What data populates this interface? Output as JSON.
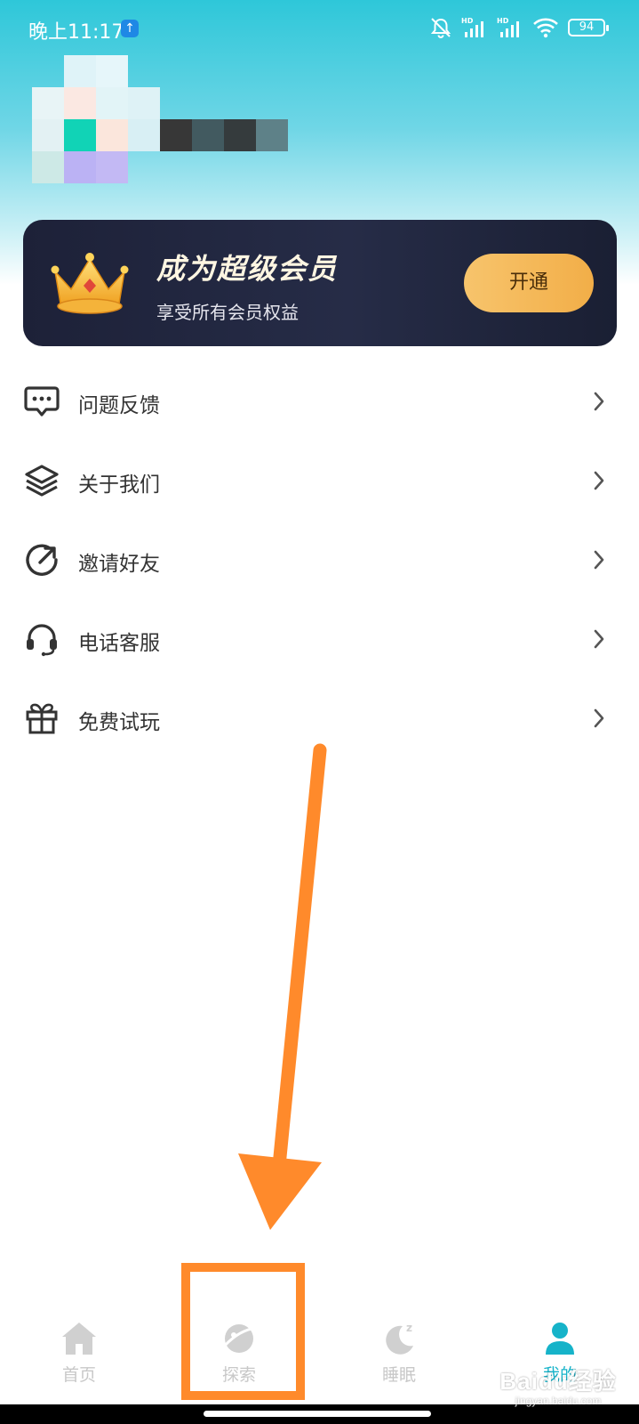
{
  "status_bar": {
    "time": "晚上11:17",
    "upload_indicator": "↑",
    "battery": "94",
    "icons": [
      "bell-off-icon",
      "hd-signal-icon",
      "hd-signal-icon",
      "wifi-icon",
      "battery-icon"
    ]
  },
  "profile": {
    "avatar": "pixelated-avatar",
    "name": "pixelated-username"
  },
  "vip_banner": {
    "title": "成为超级会员",
    "subtitle": "享受所有会员权益",
    "button_label": "开通",
    "icon": "crown-icon"
  },
  "menu": {
    "items": [
      {
        "label": "问题反馈",
        "icon": "feedback-chat-icon"
      },
      {
        "label": "关于我们",
        "icon": "layers-icon"
      },
      {
        "label": "邀请好友",
        "icon": "share-circle-arrow-icon"
      },
      {
        "label": "电话客服",
        "icon": "headset-icon"
      },
      {
        "label": "免费试玩",
        "icon": "gift-icon"
      }
    ]
  },
  "bottom_nav": {
    "items": [
      {
        "label": "首页",
        "icon": "home-icon",
        "active": false
      },
      {
        "label": "探索",
        "icon": "explore-planet-icon",
        "active": false
      },
      {
        "label": "睡眠",
        "icon": "moon-sleep-icon",
        "active": false
      },
      {
        "label": "我的",
        "icon": "user-icon",
        "active": true
      }
    ]
  },
  "watermark": {
    "main": "Baidu经验",
    "sub": "jingyan.baidu.com"
  },
  "colors": {
    "header_gradient_top": "#2ec7d9",
    "vip_card": "#1d2138",
    "vip_button": "#f2ae48",
    "nav_active": "#16b3c9",
    "annotation_orange": "#ff8a2b"
  }
}
